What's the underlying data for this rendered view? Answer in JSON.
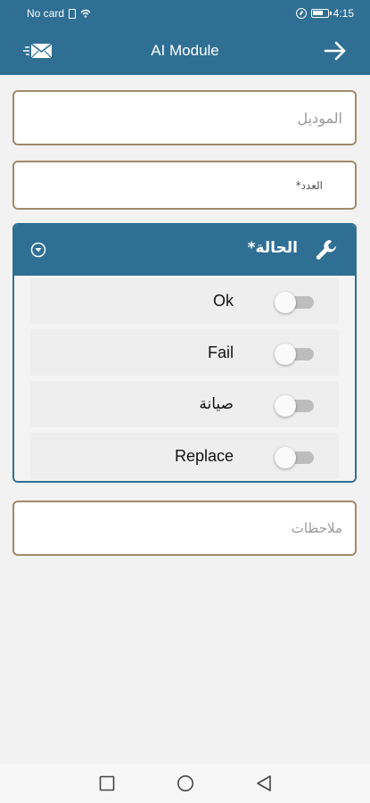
{
  "status_bar": {
    "carrier": "No card",
    "time": "4:15"
  },
  "app_bar": {
    "title": "AI Module",
    "left_icon": "mail-icon",
    "right_icon": "arrow-right-icon"
  },
  "form": {
    "model_placeholder": "الموديل",
    "count_label": "العدد*",
    "notes_placeholder": "ملاحظات"
  },
  "status_panel": {
    "title": "الحالة*",
    "header_icon": "wrench-icon",
    "collapse_icon": "chevron-down-circle-icon",
    "options": [
      {
        "label": "Ok",
        "checked": false
      },
      {
        "label": "Fail",
        "checked": false
      },
      {
        "label": "صيانة",
        "checked": false
      },
      {
        "label": "Replace",
        "checked": false
      }
    ]
  },
  "colors": {
    "primary": "#2f6f94",
    "field_border": "#a08a6c",
    "background": "#f2f2f2"
  },
  "nav_bar": {
    "icons": [
      "recent-apps-icon",
      "home-icon",
      "back-icon"
    ]
  }
}
